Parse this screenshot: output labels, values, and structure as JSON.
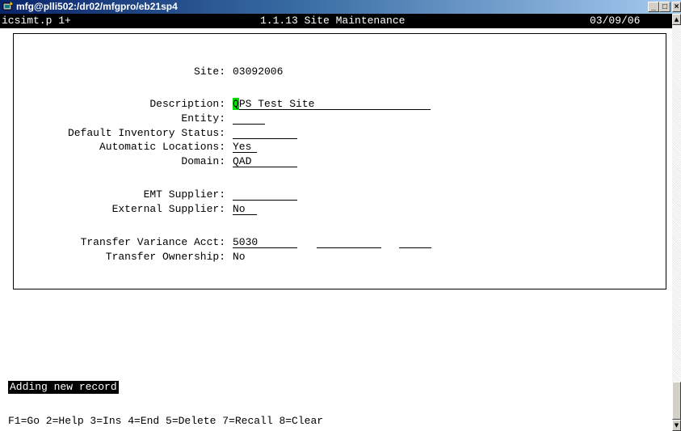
{
  "window": {
    "title": "mfg@plli502:/dr02/mfgpro/eb21sp4",
    "buttons": {
      "minimize": "_",
      "maximize": "□",
      "close": "×"
    }
  },
  "status_line": {
    "program": "icsimt.p 1+",
    "screen": "1.1.13 Site Maintenance",
    "date": "03/09/06"
  },
  "form": {
    "site": {
      "label": "Site:",
      "value": "03092006"
    },
    "description": {
      "label": "Description:",
      "cursor_char": "Q",
      "value_rest": "PS Test Site"
    },
    "entity": {
      "label": "Entity:",
      "value": ""
    },
    "default_inventory_status": {
      "label": "Default Inventory Status:",
      "value": ""
    },
    "automatic_locations": {
      "label": "Automatic Locations:",
      "value": "Yes"
    },
    "domain": {
      "label": "Domain:",
      "value": "QAD"
    },
    "emt_supplier": {
      "label": "EMT Supplier:",
      "value": ""
    },
    "external_supplier": {
      "label": "External Supplier:",
      "value": "No"
    },
    "transfer_variance_acct": {
      "label": "Transfer Variance Acct:",
      "acct": "5030",
      "sub_acct": "",
      "cost_center": ""
    },
    "transfer_ownership": {
      "label": "Transfer Ownership:",
      "value": "No"
    }
  },
  "message": "Adding new record",
  "function_keys": "F1=Go 2=Help 3=Ins 4=End 5=Delete 7=Recall 8=Clear",
  "scrollbar": {
    "up_arrow": "▲",
    "down_arrow": "▼"
  }
}
